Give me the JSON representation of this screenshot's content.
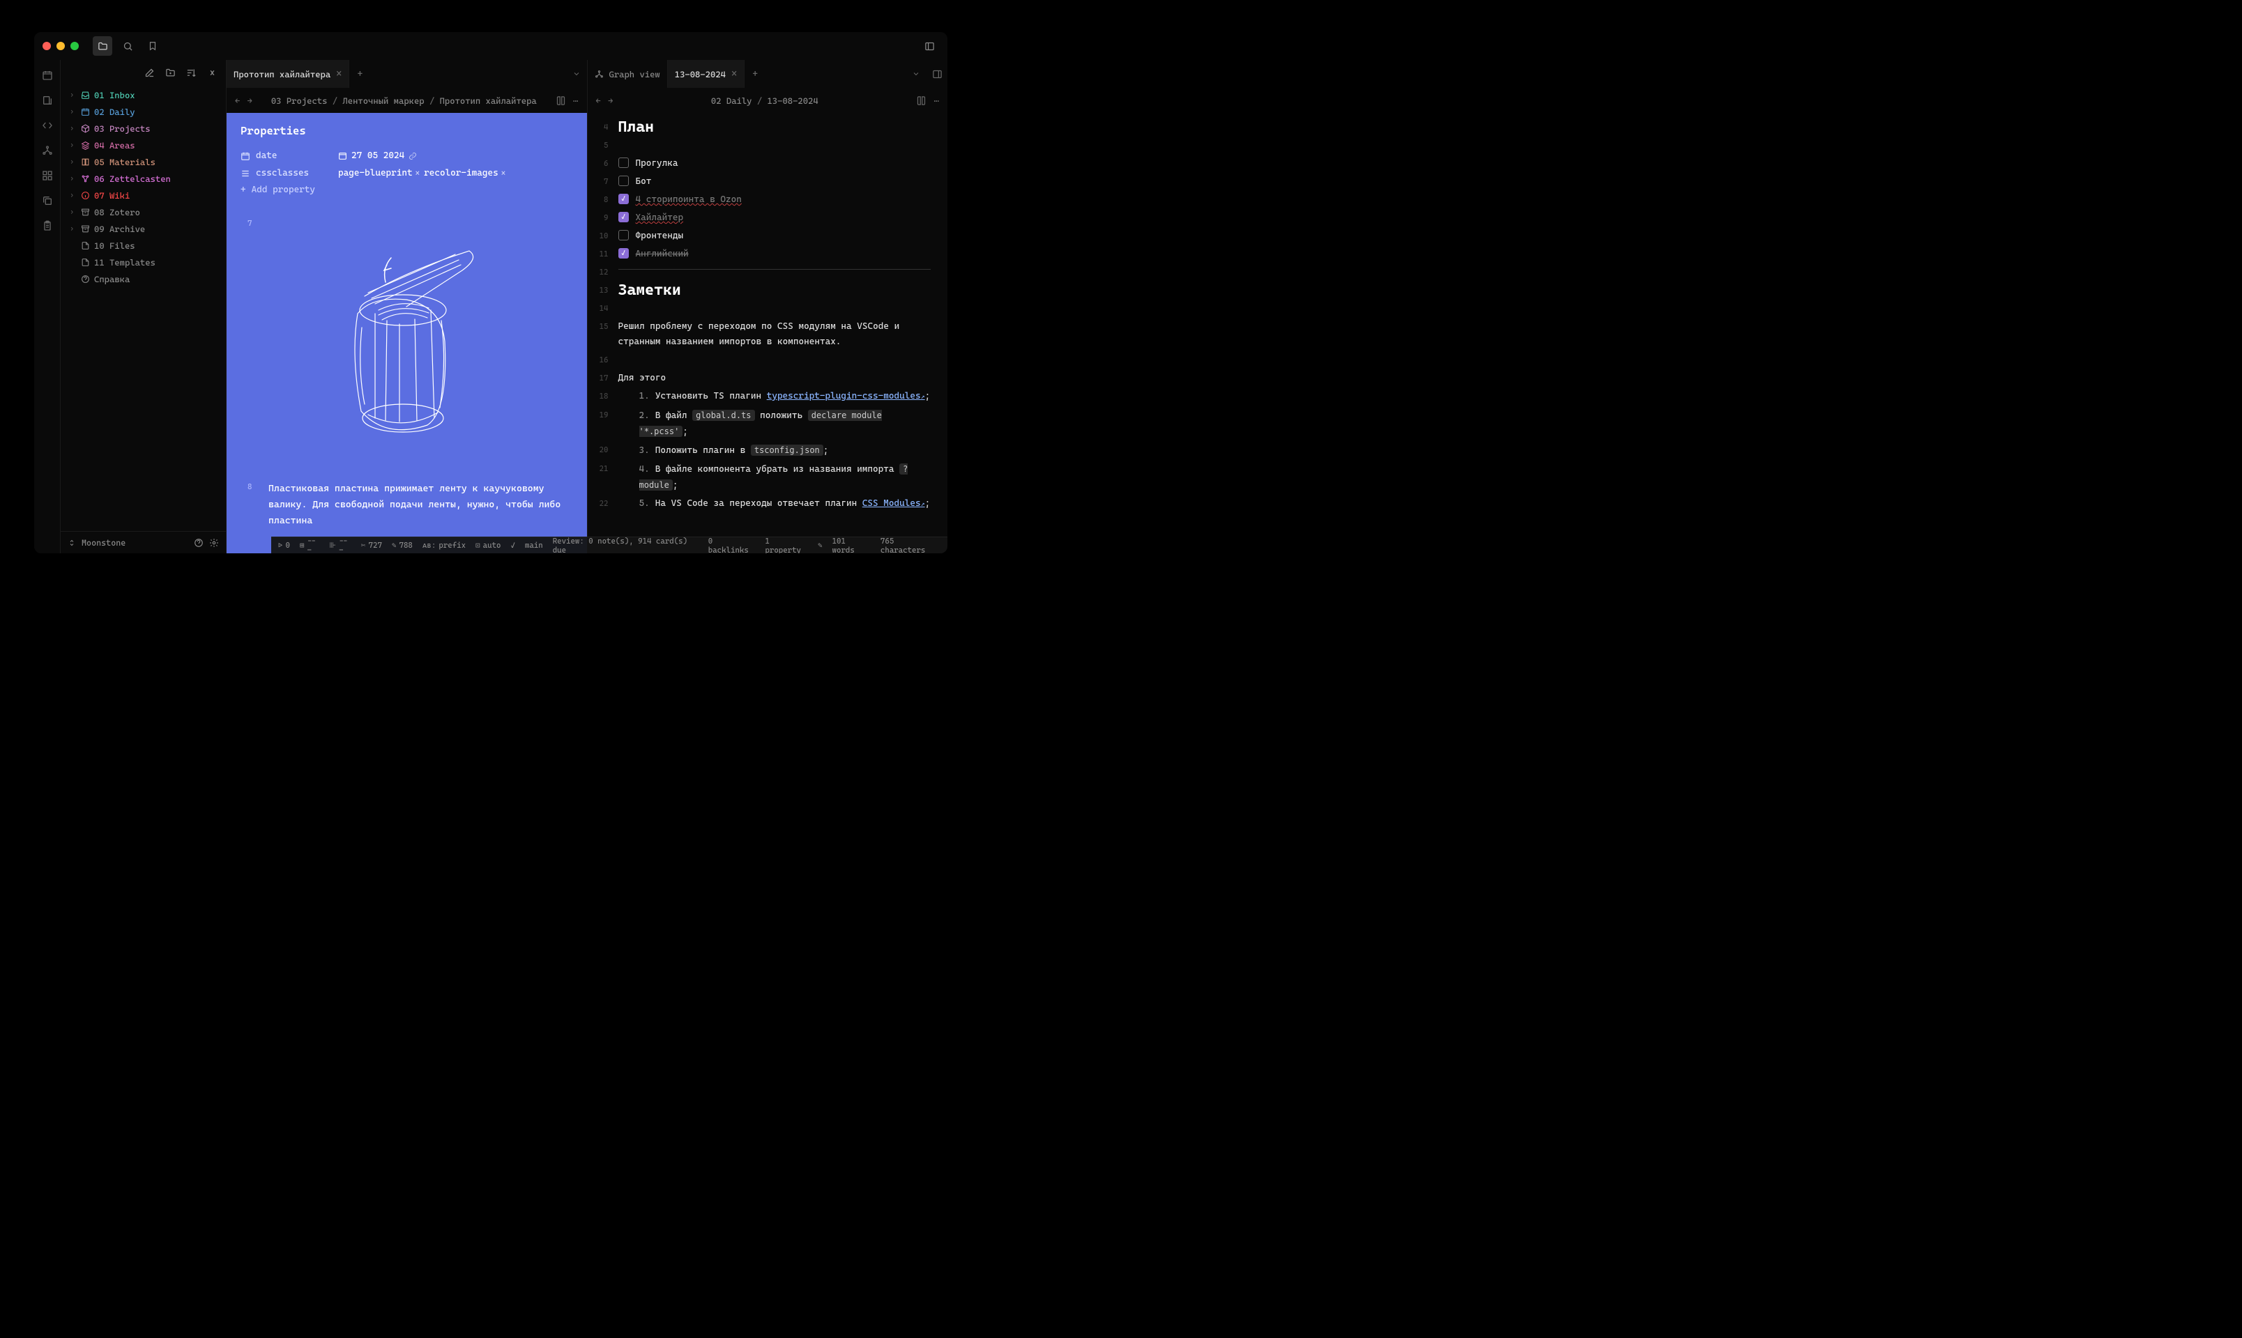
{
  "titlebar": {},
  "sidebar": {
    "items": [
      {
        "icon": "inbox",
        "label": "01 Inbox",
        "color": "c-cyan"
      },
      {
        "icon": "calendar",
        "label": "02 Daily",
        "color": "c-blue"
      },
      {
        "icon": "box",
        "label": "03 Projects",
        "color": "c-purple"
      },
      {
        "icon": "layers",
        "label": "04 Areas",
        "color": "c-pink"
      },
      {
        "icon": "book",
        "label": "05 Materials",
        "color": "c-orange"
      },
      {
        "icon": "network",
        "label": "06 Zettelcasten",
        "color": "c-magenta"
      },
      {
        "icon": "info",
        "label": "07 Wiki",
        "color": "c-red"
      },
      {
        "icon": "archive",
        "label": "08 Zotero",
        "color": "c-gray"
      },
      {
        "icon": "archive",
        "label": "09 Archive",
        "color": "c-gray"
      },
      {
        "icon": "file",
        "label": "10 Files",
        "color": "c-gray"
      },
      {
        "icon": "file",
        "label": "11 Templates",
        "color": "c-gray"
      },
      {
        "icon": "help",
        "label": "Справка",
        "color": "c-gray"
      }
    ],
    "vault": "Moonstone"
  },
  "tabs": {
    "left": [
      {
        "label": "Прототип хайлайтера",
        "active": true
      }
    ],
    "right": [
      {
        "label": "Graph view",
        "active": false,
        "icon": "graph"
      },
      {
        "label": "13-08-2024",
        "active": true
      }
    ]
  },
  "leftPane": {
    "breadcrumb": [
      "03 Projects",
      "Ленточный маркер",
      "Прототип хайлайтера"
    ],
    "propsTitle": "Properties",
    "props": {
      "dateKey": "date",
      "dateVal": "27 05 2024",
      "cssKey": "cssclasses",
      "cssVals": [
        "page-blueprint",
        "recolor-images"
      ]
    },
    "addProp": "Add property",
    "bodyLineNum": "8",
    "imgLineNum": "7",
    "body": "Пластиковая пластина прижимает ленту к каучуковому валику. Для свободной подачи ленты, нужно, чтобы либо пластина"
  },
  "rightPane": {
    "breadcrumb": [
      "02 Daily",
      "13-08-2024"
    ],
    "h_plan": "План",
    "tasks": [
      {
        "n": 6,
        "done": false,
        "text": "Прогулка"
      },
      {
        "n": 7,
        "done": false,
        "text": "Бот"
      },
      {
        "n": 8,
        "done": true,
        "text": "4 сторипоинта в Ozon",
        "spell": true
      },
      {
        "n": 9,
        "done": true,
        "text": "Хайлайтер",
        "spell": true
      },
      {
        "n": 10,
        "done": false,
        "text": "Фронтенды"
      },
      {
        "n": 11,
        "done": true,
        "text": "Английский"
      }
    ],
    "h_notes": "Заметки",
    "para": "Решил проблему с переходом по CSS модулям на VSCode и странным названием импортов в компонентах.",
    "lead": "Для этого",
    "steps": {
      "s1a": "Установить TS плагин ",
      "s1link": "typescript-plugin-css-modules",
      "s1b": ";",
      "s2a": "В файл ",
      "s2c1": "global.d.ts",
      "s2b": " положить ",
      "s2c2": "declare module '*.pcss'",
      "s2c": ";",
      "s3a": "Положить плагин в ",
      "s3c1": "tsconfig.json",
      "s3b": ";",
      "s4a": "В файле компонента убрать из названия импорта ",
      "s4c1": "?module",
      "s4b": ";",
      "s5a": "На VS Code за переходы отвечает плагин ",
      "s5link": "CSS Modules",
      "s5b": ";"
    }
  },
  "status": {
    "r0": "0",
    "dash": "---",
    "scissors": "727",
    "wand": "788",
    "prefix": "prefix",
    "auto": "auto",
    "main": "main",
    "review": "Review: 0 note(s), 914 card(s) due",
    "backlinks": "0 backlinks",
    "props": "1 property",
    "words": "101 words",
    "chars": "765 characters"
  }
}
